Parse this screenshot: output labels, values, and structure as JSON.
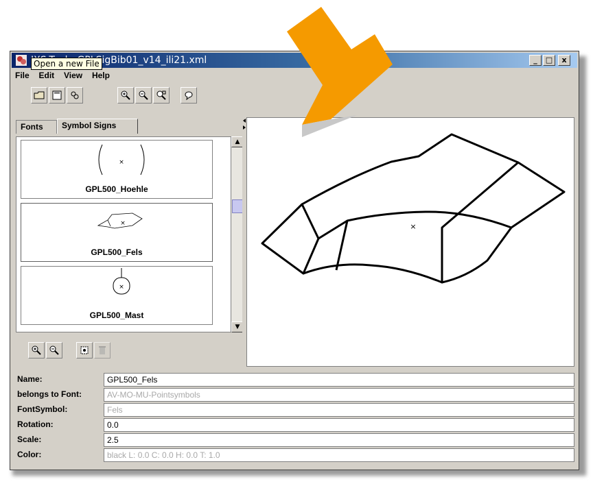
{
  "window": {
    "title": "IXS-Tool  -  GPLSigBib01_v14_ili21.xml",
    "controls": {
      "minimize": "_",
      "maximize": "□",
      "close": "x"
    }
  },
  "menu": [
    "File",
    "Edit",
    "View",
    "Help"
  ],
  "toolbar": {
    "buttons": [
      "open-file",
      "save",
      "settings",
      "zoom-in",
      "zoom-out",
      "zoom-fit",
      "comment"
    ],
    "tooltip": "Open a new File"
  },
  "tabs": [
    "Fonts",
    "Symbol Signs"
  ],
  "symbols": [
    {
      "name": "GPL500_Hoehle"
    },
    {
      "name": "GPL500_Fels"
    },
    {
      "name": "GPL500_Mast"
    }
  ],
  "properties": {
    "name": {
      "label": "Name:",
      "value": "GPL500_Fels"
    },
    "font": {
      "label": "belongs to Font:",
      "value": "AV-MO-MU-Pointsymbols"
    },
    "fontsymbol": {
      "label": "FontSymbol:",
      "value": "Fels"
    },
    "rotation": {
      "label": "Rotation:",
      "value": "0.0"
    },
    "scale": {
      "label": "Scale:",
      "value": "2.5"
    },
    "color": {
      "label": "Color:",
      "value": "black  L: 0.0  C: 0.0  H: 0.0  T: 1.0"
    }
  },
  "colors": {
    "arrow": "#f59a00",
    "titlebar_start": "#0a246a",
    "titlebar_end": "#a6caf0"
  }
}
